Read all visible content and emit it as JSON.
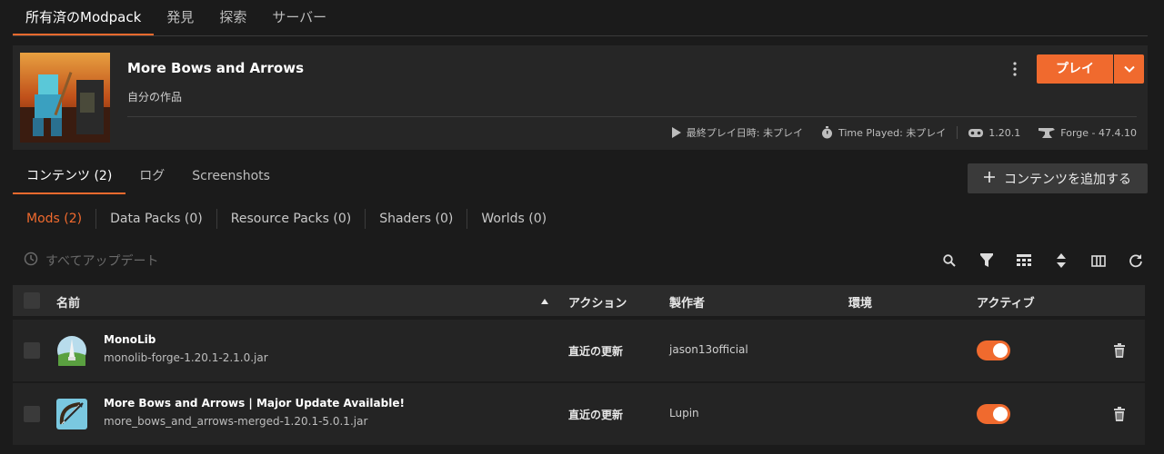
{
  "top_tabs": [
    {
      "label": "所有済のModpack",
      "active": true
    },
    {
      "label": "発見",
      "active": false
    },
    {
      "label": "探索",
      "active": false
    },
    {
      "label": "サーバー",
      "active": false
    }
  ],
  "header": {
    "title": "More Bows and Arrows",
    "subtitle": "自分の作品",
    "play_label": "プレイ",
    "last_played": "最終プレイ日時: 未プレイ",
    "time_played": "Time Played: 未プレイ",
    "game_version": "1.20.1",
    "loader": "Forge - 47.4.10"
  },
  "content_tabs": [
    {
      "label": "コンテンツ (2)",
      "active": true
    },
    {
      "label": "ログ",
      "active": false
    },
    {
      "label": "Screenshots",
      "active": false
    }
  ],
  "add_content_label": "コンテンツを追加する",
  "filters": [
    {
      "label": "Mods (2)",
      "active": true
    },
    {
      "label": "Data Packs (0)",
      "active": false
    },
    {
      "label": "Resource Packs (0)",
      "active": false
    },
    {
      "label": "Shaders (0)",
      "active": false
    },
    {
      "label": "Worlds (0)",
      "active": false
    }
  ],
  "update_all_label": "すべてアップデート",
  "columns": {
    "name": "名前",
    "action": "アクション",
    "author": "製作者",
    "environment": "環境",
    "active": "アクティブ"
  },
  "rows": [
    {
      "name": "MonoLib",
      "file": "monolib-forge-1.20.1-2.1.0.jar",
      "action": "直近の更新",
      "author": "jason13official",
      "environment": "",
      "active": true
    },
    {
      "name": "More Bows and Arrows | Major Update Available!",
      "file": "more_bows_and_arrows-merged-1.20.1-5.0.1.jar",
      "action": "直近の更新",
      "author": "Lupin",
      "environment": "",
      "active": true
    }
  ],
  "colors": {
    "accent": "#f06a2e",
    "background": "#1b1b1b",
    "card": "#262626",
    "row": "#242424"
  }
}
